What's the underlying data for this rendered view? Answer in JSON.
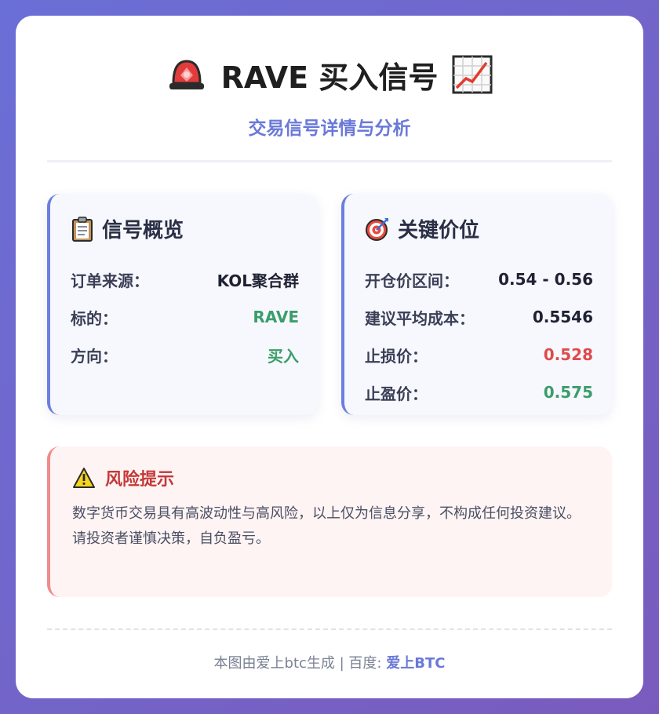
{
  "header": {
    "title": "RAVE 买入信号",
    "subtitle": "交易信号详情与分析",
    "left_icon": "siren-icon",
    "right_icon": "chart-up-icon"
  },
  "signal_overview": {
    "title": "信号概览",
    "icon": "clipboard-icon",
    "rows": [
      {
        "label": "订单来源：",
        "value": "KOL聚合群"
      },
      {
        "label": "标的：",
        "value": "RAVE"
      },
      {
        "label": "方向：",
        "value": "买入"
      }
    ]
  },
  "key_prices": {
    "title": "关键价位",
    "icon": "target-icon",
    "rows": [
      {
        "label": "开仓价区间：",
        "value": "0.54 - 0.56"
      },
      {
        "label": "建议平均成本：",
        "value": "0.5546"
      },
      {
        "label": "止损价：",
        "value": "0.528"
      },
      {
        "label": "止盈价：",
        "value": "0.575"
      }
    ]
  },
  "risk": {
    "title": "风险提示",
    "icon": "warning-icon",
    "line1": "数字货币交易具有高波动性与高风险，以上仅为信息分享，不构成任何投资建议。",
    "line2": "请投资者谨慎决策，自负盈亏。"
  },
  "footer": {
    "prefix": "本图由爱上btc生成 | 百度: ",
    "brand": "爱上BTC"
  },
  "colors": {
    "accent": "#6a79d8",
    "positive": "#3b9e6a",
    "negative": "#e04a4a"
  }
}
